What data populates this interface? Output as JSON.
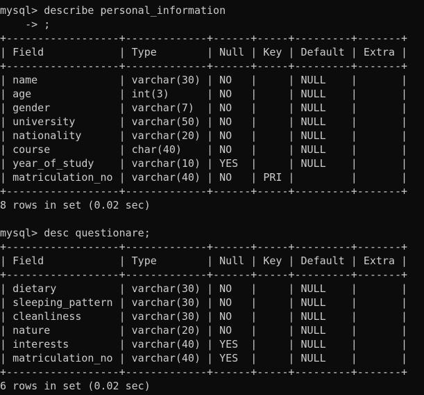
{
  "terminal": {
    "prompt": "mysql> ",
    "continuation": "    -> ",
    "colors": {
      "background": "#0c0c0c",
      "foreground": "#cccccc"
    }
  },
  "blocks": [
    {
      "command_lines": [
        "mysql> describe personal_information",
        "    -> ;"
      ],
      "headers": [
        "Field",
        "Type",
        "Null",
        "Key",
        "Default",
        "Extra"
      ],
      "rows": [
        [
          "name",
          "varchar(30)",
          "NO",
          "",
          "NULL",
          ""
        ],
        [
          "age",
          "int(3)",
          "NO",
          "",
          "NULL",
          ""
        ],
        [
          "gender",
          "varchar(7)",
          "NO",
          "",
          "NULL",
          ""
        ],
        [
          "university",
          "varchar(50)",
          "NO",
          "",
          "NULL",
          ""
        ],
        [
          "nationality",
          "varchar(20)",
          "NO",
          "",
          "NULL",
          ""
        ],
        [
          "course",
          "char(40)",
          "NO",
          "",
          "NULL",
          ""
        ],
        [
          "year_of_study",
          "varchar(10)",
          "YES",
          "",
          "NULL",
          ""
        ],
        [
          "matriculation_no",
          "varchar(40)",
          "NO",
          "PRI",
          "",
          ""
        ]
      ],
      "summary": "8 rows in set (0.02 sec)"
    },
    {
      "command_lines": [
        "mysql> desc questionare;"
      ],
      "headers": [
        "Field",
        "Type",
        "Null",
        "Key",
        "Default",
        "Extra"
      ],
      "rows": [
        [
          "dietary",
          "varchar(30)",
          "NO",
          "",
          "NULL",
          ""
        ],
        [
          "sleeping_pattern",
          "varchar(30)",
          "NO",
          "",
          "NULL",
          ""
        ],
        [
          "cleanliness",
          "varchar(30)",
          "NO",
          "",
          "NULL",
          ""
        ],
        [
          "nature",
          "varchar(20)",
          "NO",
          "",
          "NULL",
          ""
        ],
        [
          "interests",
          "varchar(40)",
          "YES",
          "",
          "NULL",
          ""
        ],
        [
          "matriculation_no",
          "varchar(40)",
          "YES",
          "",
          "NULL",
          ""
        ]
      ],
      "summary": "6 rows in set (0.02 sec)"
    }
  ]
}
